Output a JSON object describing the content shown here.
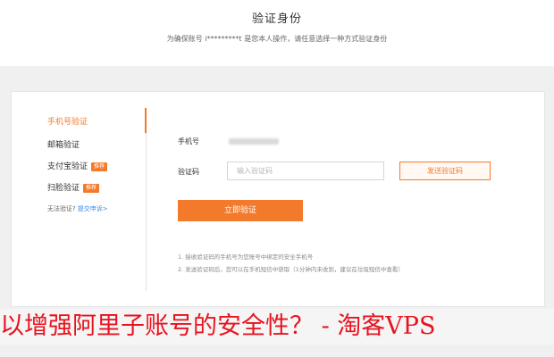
{
  "header": {
    "title": "验证身份",
    "subtitle": "为确保账号 i*********t 是您本人操作，请任意选择一种方式验证身份"
  },
  "sidebar": {
    "items": [
      {
        "label": "手机号验证",
        "badge": "",
        "active": true
      },
      {
        "label": "邮箱验证",
        "badge": "",
        "active": false
      },
      {
        "label": "支付宝验证",
        "badge": "推荐",
        "active": false
      },
      {
        "label": "扫脸验证",
        "badge": "推荐",
        "active": false
      }
    ],
    "cannot_verify": "无法验证?",
    "submit_appeal": "提交申诉>"
  },
  "form": {
    "phone_label": "手机号",
    "code_label": "验证码",
    "code_placeholder": "输入验证码",
    "send_code_label": "发送验证码",
    "submit_label": "立即验证",
    "notes": [
      "1. 接收验证码的手机号为您账号中绑定的安全手机号",
      "2. 发送验证码后，您可以在手机短信中获取（1分钟内未收到，建议在垃圾短信中查看）"
    ]
  },
  "caption": {
    "text": "以增强阿里子账号的安全性？ - 淘客VPS"
  },
  "colors": {
    "accent": "#f37a2b",
    "link": "#3c8be0",
    "caption": "#e8131f"
  }
}
